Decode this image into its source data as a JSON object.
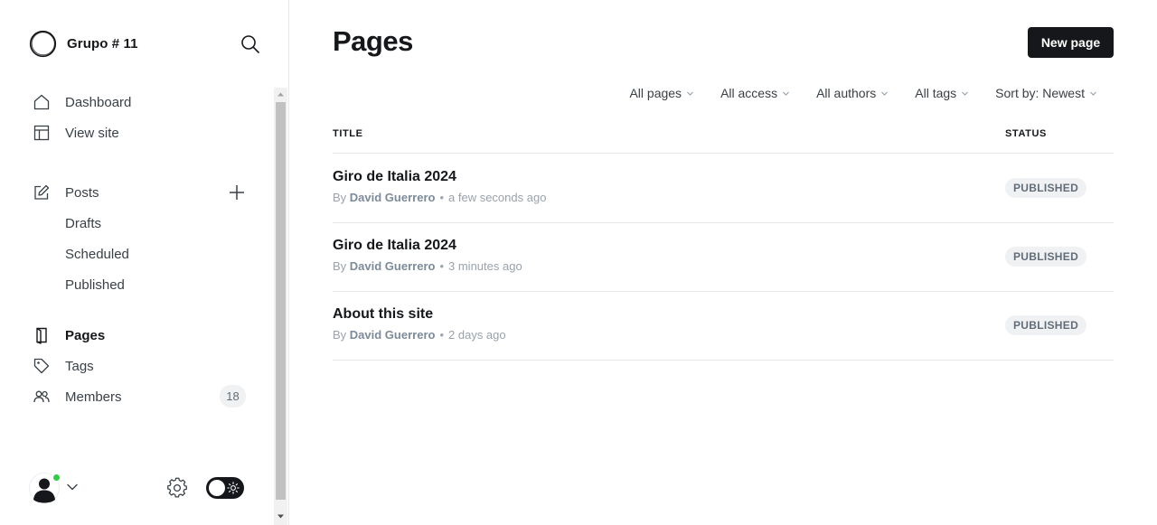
{
  "brand": {
    "name": "Grupo # 11"
  },
  "sidebar": {
    "nav": [
      {
        "label": "Dashboard",
        "icon": "house-icon"
      },
      {
        "label": "View site",
        "icon": "layout-icon"
      }
    ],
    "posts": {
      "label": "Posts",
      "icon": "pencil-edit-icon",
      "sub": [
        "Drafts",
        "Scheduled",
        "Published"
      ]
    },
    "nav2": [
      {
        "label": "Pages",
        "icon": "page-icon",
        "active": true
      },
      {
        "label": "Tags",
        "icon": "tag-icon"
      },
      {
        "label": "Members",
        "icon": "members-icon",
        "count": "18"
      }
    ],
    "footer": {
      "online_color": "#30cf43",
      "theme": "dark"
    }
  },
  "main": {
    "title": "Pages",
    "new_button": "New page",
    "filters": [
      "All pages",
      "All access",
      "All authors",
      "All tags",
      "Sort by: Newest"
    ],
    "columns": {
      "title": "TITLE",
      "status": "STATUS"
    },
    "rows": [
      {
        "title": "Giro de Italia 2024",
        "by": "By",
        "author": "David Guerrero",
        "time": "a few seconds ago",
        "status": "PUBLISHED"
      },
      {
        "title": "Giro de Italia 2024",
        "by": "By",
        "author": "David Guerrero",
        "time": "3 minutes ago",
        "status": "PUBLISHED"
      },
      {
        "title": "About this site",
        "by": "By",
        "author": "David Guerrero",
        "time": "2 days ago",
        "status": "PUBLISHED"
      }
    ]
  },
  "colors": {
    "primary": "#15171a",
    "text": "#394047",
    "muted": "#99a3ad",
    "badge_bg": "#eff1f2",
    "border": "#e6e9eb"
  }
}
